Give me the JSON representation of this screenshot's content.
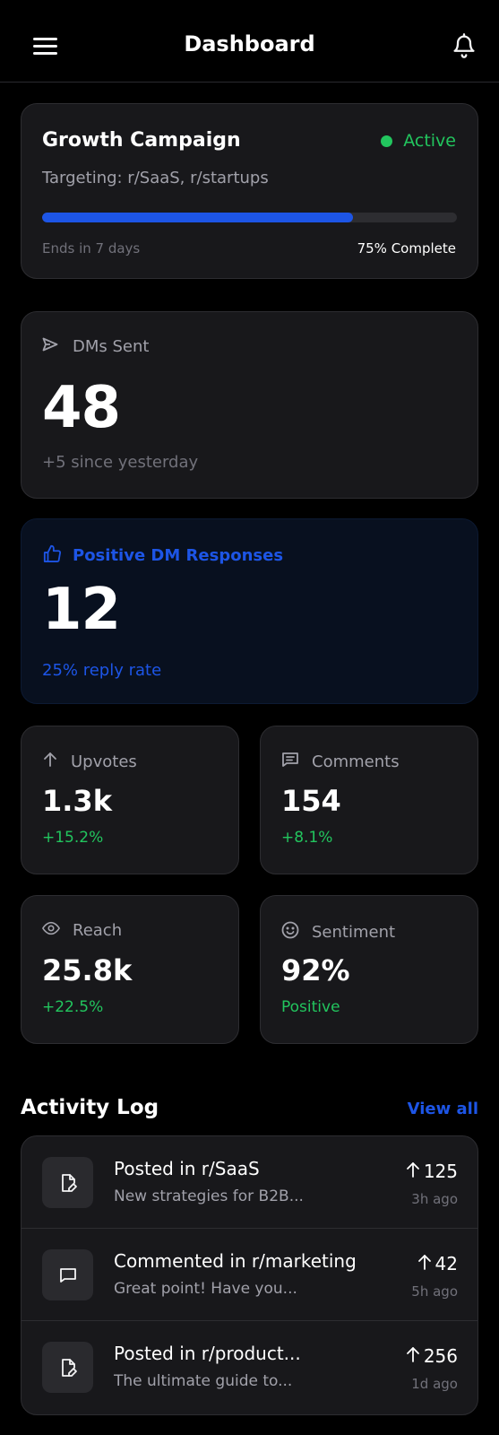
{
  "header": {
    "title": "Dashboard",
    "menu_icon": "menu-icon",
    "notify_icon": "bell-icon"
  },
  "campaign": {
    "name": "Growth Campaign",
    "status": "Active",
    "targeting": "Targeting: r/SaaS, r/startups",
    "progress": 0.75,
    "ends": "Ends in 7 days",
    "complete": "75% Complete"
  },
  "dms": {
    "label": "DMs Sent",
    "value": "48",
    "sub": "+5 since yesterday",
    "icon": "send-icon"
  },
  "positive": {
    "label": "Positive DM Responses",
    "value": "12",
    "sub": "25% reply rate",
    "icon": "thumbs-up-icon"
  },
  "stats": [
    {
      "label": "Upvotes",
      "value": "1.3k",
      "delta": "+15.2%",
      "icon": "arrow-up-icon"
    },
    {
      "label": "Comments",
      "value": "154",
      "delta": "+8.1%",
      "icon": "comment-icon"
    },
    {
      "label": "Reach",
      "value": "25.8k",
      "delta": "+22.5%",
      "icon": "eye-icon"
    },
    {
      "label": "Sentiment",
      "value": "92%",
      "delta": "Positive",
      "icon": "smile-icon"
    }
  ],
  "activity": {
    "title": "Activity Log",
    "view_all": "View all",
    "items": [
      {
        "title": "Posted in r/SaaS",
        "sub": "New strategies for B2B...",
        "count": "125",
        "time": "3h ago",
        "icon": "post-edit-icon"
      },
      {
        "title": "Commented in r/marketing",
        "sub": "Great point! Have you...",
        "count": "42",
        "time": "5h ago",
        "icon": "comment-icon"
      },
      {
        "title": "Posted in r/product...",
        "sub": "The ultimate guide to...",
        "count": "256",
        "time": "1d ago",
        "icon": "post-edit-icon"
      }
    ]
  },
  "colors": {
    "accent": "#1d55e6",
    "success": "#22c55e",
    "card": "#18181b",
    "background": "#000000"
  }
}
